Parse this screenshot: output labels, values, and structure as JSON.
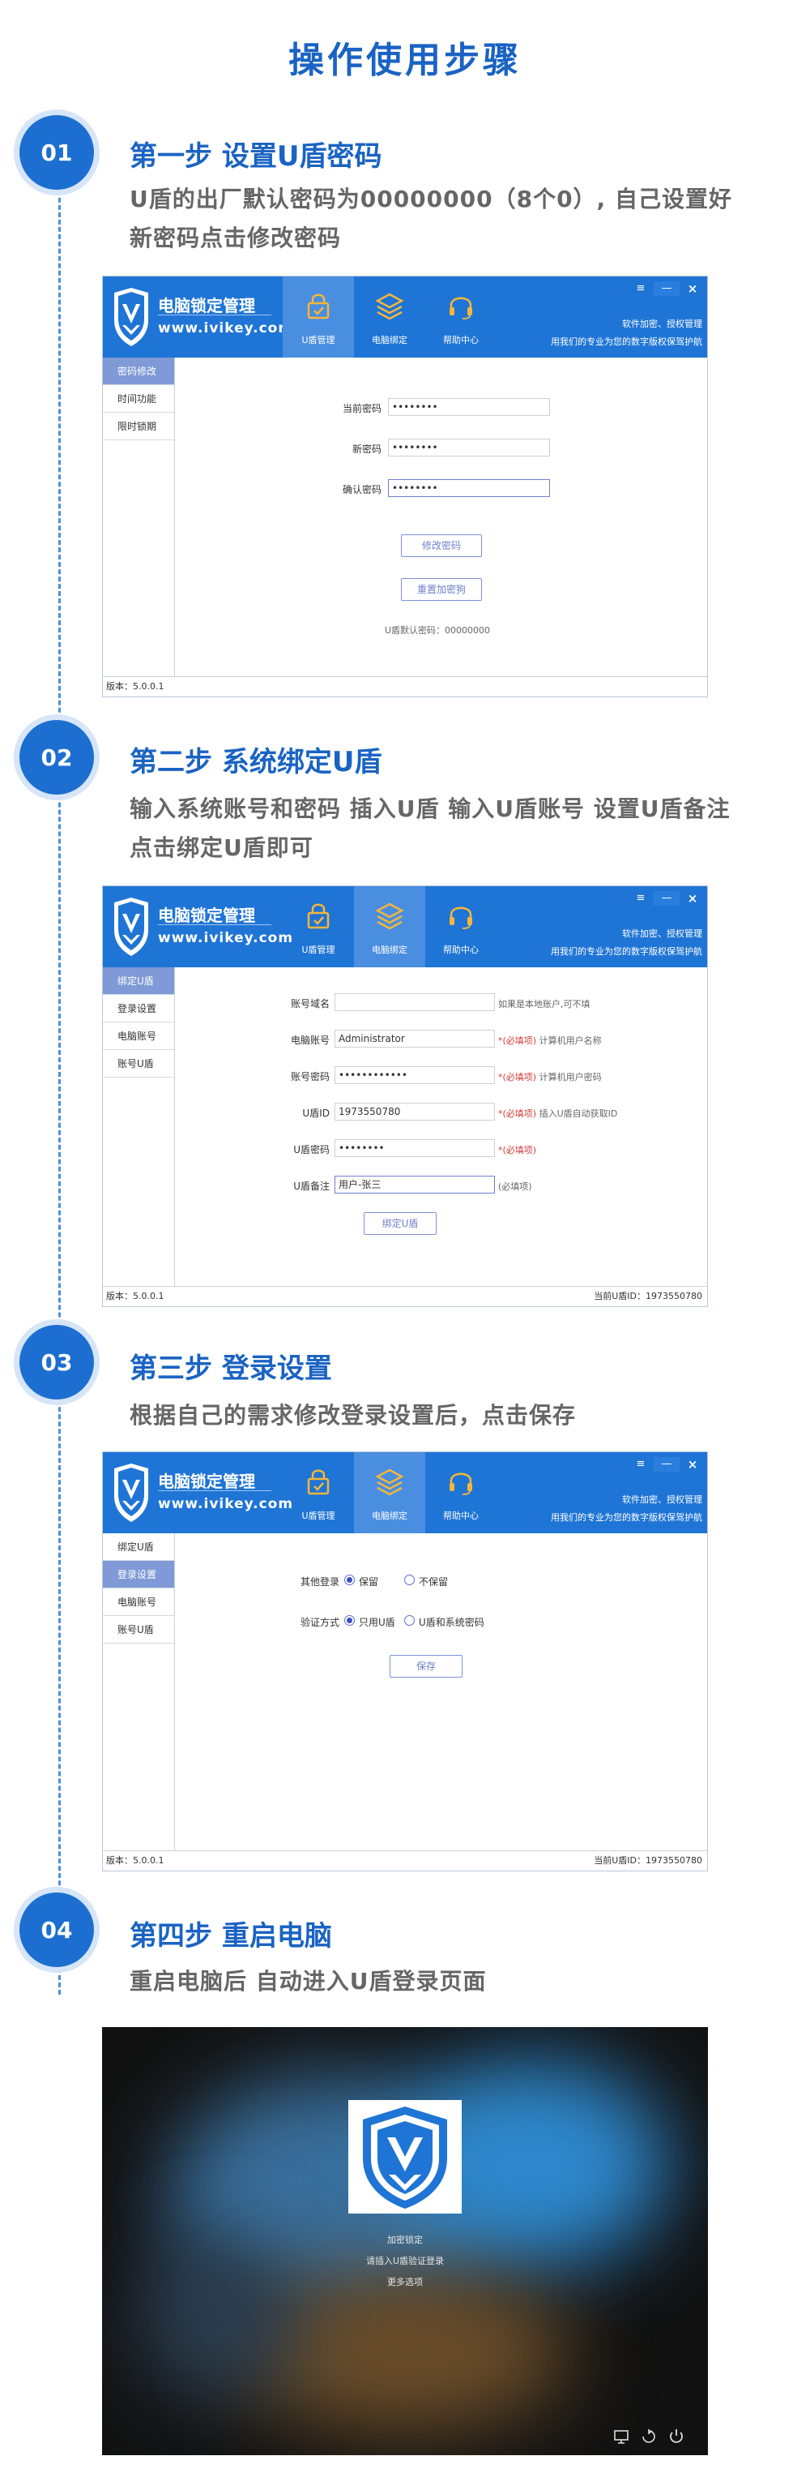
{
  "page": {
    "title": "操作使用步骤"
  },
  "steps": [
    {
      "num": "01",
      "heading": "第一步 设置U盾密码",
      "desc_lines": [
        "U盾的出厂默认密码为00000000（8个0）, 自己设置好",
        "新密码点击修改密码"
      ]
    },
    {
      "num": "02",
      "heading": "第二步 系统绑定U盾",
      "desc_lines": [
        "输入系统账号和密码  插入U盾  输入U盾账号  设置U盾备注",
        "点击绑定U盾即可"
      ]
    },
    {
      "num": "03",
      "heading": "第三步 登录设置",
      "desc_lines": [
        "根据自己的需求修改登录设置后，点击保存"
      ]
    },
    {
      "num": "04",
      "heading": "第四步 重启电脑",
      "desc_lines": [
        "重启电脑后  自动进入U盾登录页面"
      ]
    }
  ],
  "app": {
    "brand_name": "电脑锁定管理",
    "brand_url": "www.ivikey.com",
    "nav": [
      "U盾管理",
      "电脑绑定",
      "帮助中心"
    ],
    "header_right_line1": "软件加密、授权管理",
    "header_right_line2": "用我们的专业为您的数字版权保驾护航",
    "win_controls": {
      "menu": "≡",
      "min": "—",
      "close": "×"
    },
    "version": "版本：5.0.0.1",
    "device_id_label": "当前U盾ID：1973550780"
  },
  "screen1": {
    "sidebar": [
      "密码修改",
      "时间功能",
      "限时锁期"
    ],
    "fields": [
      {
        "label": "当前密码",
        "value": "••••••••"
      },
      {
        "label": "新密码",
        "value": "••••••••"
      },
      {
        "label": "确认密码",
        "value": "••••••••"
      }
    ],
    "btn_change": "修改密码",
    "btn_reset": "重置加密狗",
    "default_note": "U盾默认密码：00000000"
  },
  "screen2": {
    "sidebar": [
      "绑定U盾",
      "登录设置",
      "电脑账号",
      "账号U盾"
    ],
    "fields": [
      {
        "label": "账号域名",
        "value": "",
        "req": "",
        "hint": "如果是本地账户,可不填"
      },
      {
        "label": "电脑账号",
        "value": "Administrator",
        "req": "*(必填项)",
        "hint": "计算机用户名称"
      },
      {
        "label": "账号密码",
        "value": "••••••••••••",
        "req": "*(必填项)",
        "hint": "计算机用户密码"
      },
      {
        "label": "U盾ID",
        "value": "1973550780",
        "req": "*(必填项)",
        "hint": "插入U盾自动获取ID"
      },
      {
        "label": "U盾密码",
        "value": "••••••••",
        "req": "*(必填项)",
        "hint": ""
      },
      {
        "label": "U盾备注",
        "value": "用户-张三",
        "req": "",
        "hint": "(必填项)"
      }
    ],
    "btn_bind": "绑定U盾"
  },
  "screen3": {
    "sidebar": [
      "绑定U盾",
      "登录设置",
      "电脑账号",
      "账号U盾"
    ],
    "other_login_label": "其他登录",
    "other_login_opt1": "保留",
    "other_login_opt2": "不保留",
    "verify_label": "验证方式",
    "verify_opt1": "只用U盾",
    "verify_opt2": "U盾和系统密码",
    "btn_save": "保存"
  },
  "login": {
    "line1": "加密锁定",
    "line2": "请插入U盾验证登录",
    "line3": "更多选项"
  },
  "colors": {
    "accent": "#1f75d5",
    "heading": "#1a63c3",
    "step_circle": "#1c6fd0"
  }
}
